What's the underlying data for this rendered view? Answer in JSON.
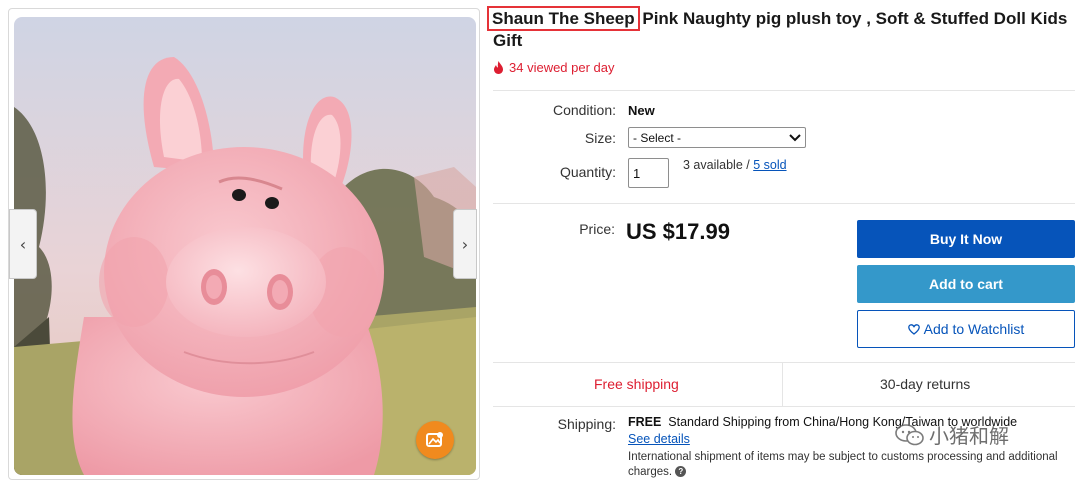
{
  "product": {
    "title_highlight": "Shaun The Sheep",
    "title_rest": " Pink Naughty pig plush toy , Soft & Stuffed Doll Kids Gift",
    "views": "34 viewed per day"
  },
  "details": {
    "condition_label": "Condition:",
    "condition_value": "New",
    "size_label": "Size:",
    "size_selected": "- Select -",
    "quantity_label": "Quantity:",
    "quantity_value": "1",
    "available_text": "3 available / ",
    "sold_link": "5 sold"
  },
  "pricing": {
    "price_label": "Price:",
    "price_value": "US $17.99",
    "buy_now": "Buy It Now",
    "add_to_cart": "Add to cart",
    "add_to_watchlist": "Add to Watchlist"
  },
  "shipping": {
    "free_shipping": "Free shipping",
    "returns": "30-day returns",
    "shipping_label": "Shipping:",
    "shipping_free": "FREE",
    "shipping_desc": "Standard Shipping from China/Hong Kong/Taiwan to worldwide",
    "see_details": "See details",
    "international_note": "International shipment of items may be subject to customs processing and additional charges."
  },
  "watermark": {
    "text": "小猪和解"
  },
  "colors": {
    "buy_now_bg": "#0654ba",
    "cart_bg": "#3498ca",
    "alert_red": "#dd1e31",
    "highlight_box": "#e53238",
    "zoom_orange": "#f08a1e"
  }
}
